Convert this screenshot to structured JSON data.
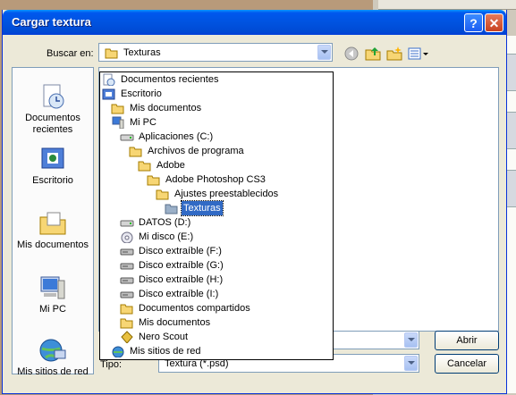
{
  "window": {
    "title": "Cargar textura",
    "help_label": "?",
    "close_label": "✕"
  },
  "lookin": {
    "label": "Buscar en:",
    "value": "Texturas"
  },
  "places": [
    {
      "label": "Documentos recientes",
      "icon": "recent-documents-icon"
    },
    {
      "label": "Escritorio",
      "icon": "desktop-icon"
    },
    {
      "label": "Mis documentos",
      "icon": "my-documents-icon"
    },
    {
      "label": "Mi PC",
      "icon": "my-computer-icon"
    },
    {
      "label": "Mis sitios de red",
      "icon": "network-places-icon"
    }
  ],
  "dropdown": [
    {
      "label": "Documentos recientes",
      "icon": "recent-documents-icon",
      "level": 0
    },
    {
      "label": "Escritorio",
      "icon": "desktop-icon",
      "level": 0
    },
    {
      "label": "Mis documentos",
      "icon": "folder-icon",
      "level": 1
    },
    {
      "label": "Mi PC",
      "icon": "my-computer-icon",
      "level": 1
    },
    {
      "label": "Aplicaciones (C:)",
      "icon": "drive-icon",
      "level": 2
    },
    {
      "label": "Archivos de programa",
      "icon": "folder-icon",
      "level": 3
    },
    {
      "label": "Adobe",
      "icon": "folder-icon",
      "level": 4
    },
    {
      "label": "Adobe Photoshop CS3",
      "icon": "folder-icon",
      "level": 5
    },
    {
      "label": "Ajustes preestablecidos",
      "icon": "folder-icon",
      "level": 6
    },
    {
      "label": "Texturas",
      "icon": "open-folder-icon",
      "level": 7,
      "selected": true
    },
    {
      "label": "DATOS (D:)",
      "icon": "drive-icon",
      "level": 2
    },
    {
      "label": "Mi disco (E:)",
      "icon": "cd-drive-icon",
      "level": 2
    },
    {
      "label": "Disco extraíble (F:)",
      "icon": "removable-drive-icon",
      "level": 2
    },
    {
      "label": "Disco extraíble (G:)",
      "icon": "removable-drive-icon",
      "level": 2
    },
    {
      "label": "Disco extraíble (H:)",
      "icon": "removable-drive-icon",
      "level": 2
    },
    {
      "label": "Disco extraíble (I:)",
      "icon": "removable-drive-icon",
      "level": 2
    },
    {
      "label": "Documentos compartidos",
      "icon": "folder-icon",
      "level": 2
    },
    {
      "label": "Mis documentos",
      "icon": "folder-icon",
      "level": 2
    },
    {
      "label": "Nero Scout",
      "icon": "nero-scout-icon",
      "level": 2
    },
    {
      "label": "Mis sitios de red",
      "icon": "network-places-icon",
      "level": 1
    }
  ],
  "filename": {
    "value": ""
  },
  "filetype": {
    "label": "Tipo:",
    "value": "Textura (*.psd)"
  },
  "buttons": {
    "open": "Abrir",
    "cancel": "Cancelar"
  },
  "colors": {
    "titlebar": "#0054e3",
    "selection": "#316ac5",
    "dialog_bg": "#ece9d8"
  }
}
